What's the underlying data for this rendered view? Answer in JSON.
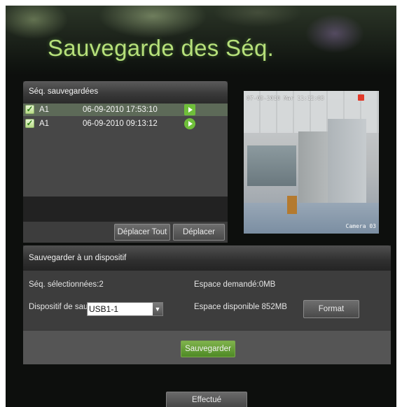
{
  "title": "Sauvegarde des Séq.",
  "recorded": {
    "header": "Séq. sauvegardées",
    "items": [
      {
        "camera": "A1",
        "time": "06-09-2010 17:53:10",
        "selected": true,
        "checked": true
      },
      {
        "camera": "A1",
        "time": "06-09-2010 09:13:12",
        "selected": false,
        "checked": true
      }
    ],
    "move_all_label": "Déplacer Tout",
    "move_label": "Déplacer"
  },
  "preview": {
    "timestamp": "07-09-2010 Mar 11:12:03",
    "camera_label": "Camera 03"
  },
  "device": {
    "header": "Sauvegarder à un dispositif",
    "selected_clips": "Séq. sélectionnées:2",
    "space_required": "Espace demandé:0MB",
    "device_label": "Dispositif de sauve",
    "device_value": "USB1-1",
    "space_available": "Espace disponible 852MB",
    "format_label": "Format",
    "save_label": "Sauvegarder"
  },
  "done_label": "Effectué",
  "colors": {
    "title": "#b6e07a",
    "accent": "#6fbf3a",
    "panel": "#3d3d3d"
  },
  "icons": {
    "checkbox": "check-icon",
    "play": "play-icon",
    "dropdown": "chevron-down-icon"
  }
}
